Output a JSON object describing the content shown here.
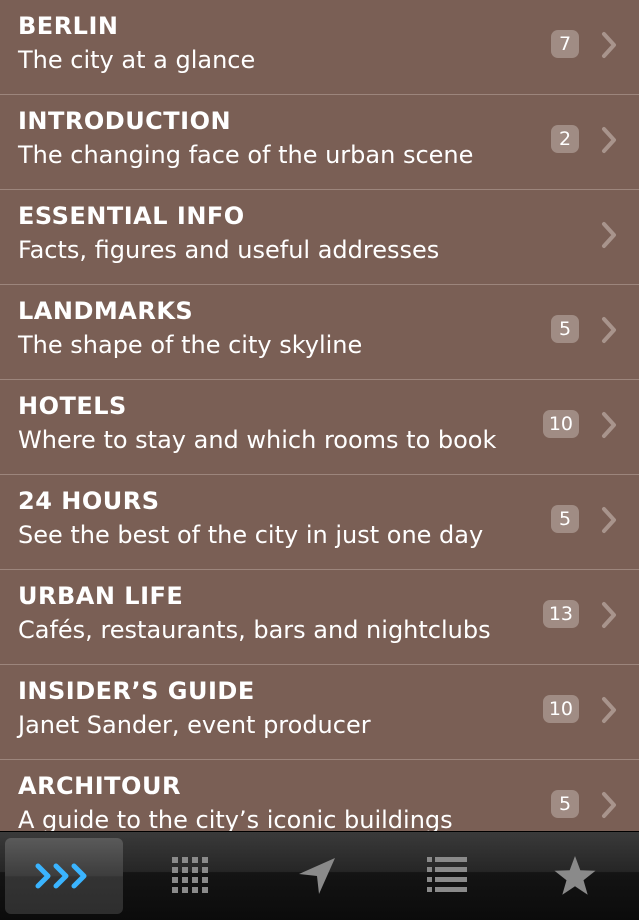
{
  "colors": {
    "row_bg": "#7a5f55",
    "row_divider": "#9c857c",
    "badge_bg": "#a08c84",
    "chevron": "#a8948c",
    "tab_active_icon": "#3ab4ff",
    "tab_icon": "#8a8a8a"
  },
  "sections": [
    {
      "title": "BERLIN",
      "subtitle": "The city at a glance",
      "count": "7"
    },
    {
      "title": "INTRODUCTION",
      "subtitle": "The changing face of the urban scene",
      "count": "2"
    },
    {
      "title": "ESSENTIAL INFO",
      "subtitle": "Facts, figures and useful addresses",
      "count": ""
    },
    {
      "title": "LANDMARKS",
      "subtitle": "The shape of the city skyline",
      "count": "5"
    },
    {
      "title": "HOTELS",
      "subtitle": "Where to stay and which rooms to book",
      "count": "10"
    },
    {
      "title": "24 HOURS",
      "subtitle": "See the best of the city in just one day",
      "count": "5"
    },
    {
      "title": "URBAN LIFE",
      "subtitle": "Cafés, restaurants, bars and nightclubs",
      "count": "13"
    },
    {
      "title": "INSIDER’S GUIDE",
      "subtitle": "Janet Sander, event producer",
      "count": "10"
    },
    {
      "title": "ARCHITOUR",
      "subtitle": "A guide to the city’s iconic buildings",
      "count": "5"
    }
  ],
  "tabbar": {
    "tabs": [
      {
        "icon": "forward-chevrons-icon",
        "active": true
      },
      {
        "icon": "grid-icon",
        "active": false
      },
      {
        "icon": "location-arrow-icon",
        "active": false
      },
      {
        "icon": "list-icon",
        "active": false
      },
      {
        "icon": "star-icon",
        "active": false
      }
    ]
  }
}
